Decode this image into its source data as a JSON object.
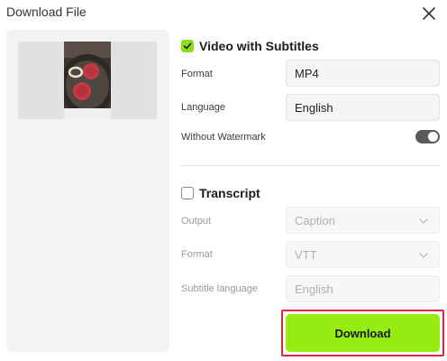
{
  "dialog": {
    "title": "Download File"
  },
  "video_subtitles": {
    "label": "Video with Subtitles",
    "checked": true,
    "format": {
      "label": "Format",
      "value": "MP4"
    },
    "language": {
      "label": "Language",
      "value": "English"
    },
    "watermark": {
      "label": "Without Watermark",
      "enabled": true
    }
  },
  "transcript": {
    "label": "Transcript",
    "checked": false,
    "output": {
      "label": "Output",
      "value": "Caption"
    },
    "format": {
      "label": "Format",
      "value": "VTT"
    },
    "subtitle_language": {
      "label": "Subtitle language",
      "value": "English"
    }
  },
  "download": {
    "label": "Download"
  },
  "colors": {
    "accent_green": "#97ec11",
    "checkbox_green": "#8dde1a",
    "highlight_red": "#e0263a",
    "toggle_on": "#5a5a5a"
  },
  "icons": [
    "close-icon",
    "checkmark-icon",
    "chevron-down-icon"
  ]
}
